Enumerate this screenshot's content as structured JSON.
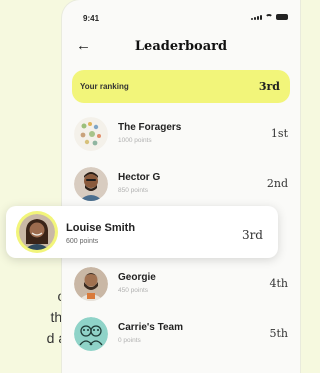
{
  "partial_text": {
    "lines": [
      "or",
      "the",
      "d at"
    ]
  },
  "status_bar": {
    "time": "9:41"
  },
  "header": {
    "title": "Leaderboard"
  },
  "your_ranking": {
    "label": "Your ranking",
    "rank": "3rd"
  },
  "leaderboard": [
    {
      "name": "The Foragers",
      "points": "1000 points",
      "rank": "1st"
    },
    {
      "name": "Hector G",
      "points": "850 points",
      "rank": "2nd"
    },
    {
      "name": "Georgie",
      "points": "450 points",
      "rank": "4th"
    },
    {
      "name": "Carrie's Team",
      "points": "0 points",
      "rank": "5th"
    }
  ],
  "highlight": {
    "name": "Louise Smith",
    "points": "600 points",
    "rank": "3rd"
  },
  "colors": {
    "background": "#F6F9DF",
    "accent": "#F2F57A"
  }
}
